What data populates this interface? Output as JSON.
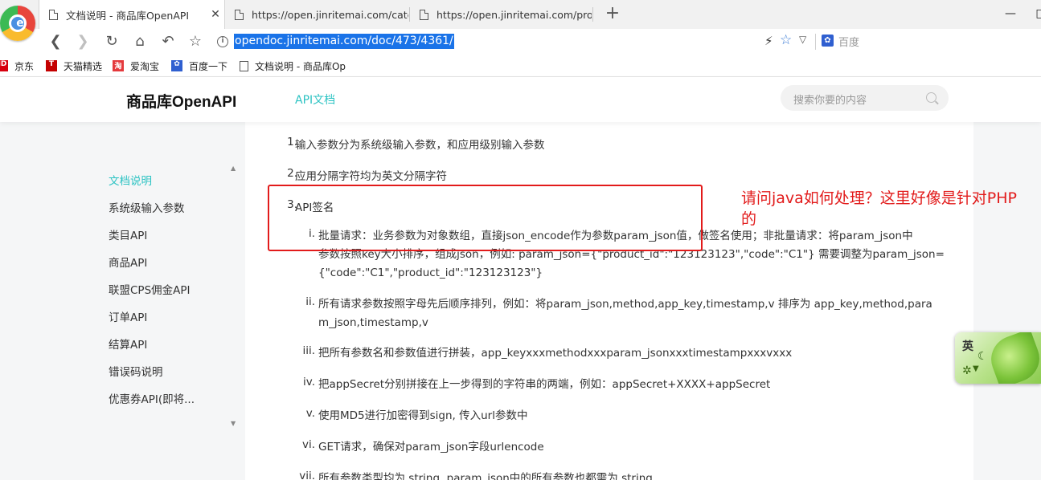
{
  "browser": {
    "tabs": [
      {
        "label": "文档说明 - 商品库OpenAPI",
        "active": true
      },
      {
        "label": "https://open.jinritemai.com/cate/",
        "active": false
      },
      {
        "label": "https://open.jinritemai.com/prod",
        "active": false
      }
    ],
    "new_tab_glyph": "+",
    "window_buttons": {
      "minimize": "—",
      "maximize": "□"
    },
    "url": "opendoc.jinritemai.com/doc/473/4361/",
    "search_placeholder": "百度",
    "bookmarks": [
      {
        "label": "京东",
        "icon": "jd-icon",
        "color": "#d7000f"
      },
      {
        "label": "天猫精选",
        "icon": "tmall-icon",
        "color": "#c40000"
      },
      {
        "label": "爱淘宝",
        "icon": "taobao-icon",
        "color": "#e4393c"
      },
      {
        "label": "百度一下",
        "icon": "baidu-icon",
        "color": "#2f5fd0"
      },
      {
        "label": "文档说明 - 商品库Op",
        "icon": "page-icon",
        "color": "#555555"
      }
    ]
  },
  "site": {
    "title": "商品库OpenAPI",
    "nav_link": "API文档",
    "search_placeholder": "搜索你要的内容",
    "accent_color": "#2cc3c3"
  },
  "sidebar": {
    "items": [
      {
        "label": "文档说明",
        "active": true
      },
      {
        "label": "系统级输入参数",
        "active": false
      },
      {
        "label": "类目API",
        "active": false
      },
      {
        "label": "商品API",
        "active": false
      },
      {
        "label": "联盟CPS佣金API",
        "active": false
      },
      {
        "label": "订单API",
        "active": false
      },
      {
        "label": "结算API",
        "active": false
      },
      {
        "label": "错误码说明",
        "active": false
      },
      {
        "label": "优惠券API(即将...",
        "active": false
      }
    ]
  },
  "doc": {
    "items": [
      {
        "num": "1.",
        "text": "输入参数分为系统级输入参数，和应用级别输入参数"
      },
      {
        "num": "2.",
        "text": "应用分隔字符均为英文分隔字符"
      },
      {
        "num": "3.",
        "text": "API签名"
      }
    ],
    "sub_items": [
      {
        "num": "i.",
        "lines": [
          "批量请求：业务参数为对象数组，直接json_encode作为参数param_json值，做签名使用；非批量请求：将param_json中",
          "参数按照key大小排序，组成json，例如: param_json={\"product_id\":\"123123123\",\"code\":\"C1\"} 需要调整为param_json=",
          "{\"code\":\"C1\",\"product_id\":\"123123123\"}"
        ]
      },
      {
        "num": "ii.",
        "lines": [
          "所有请求参数按照字母先后顺序排列，例如：将param_json,method,app_key,timestamp,v 排序为 app_key,method,para",
          "m_json,timestamp,v"
        ]
      },
      {
        "num": "iii.",
        "lines": [
          "把所有参数名和参数值进行拼装，app_keyxxxmethodxxxparam_jsonxxxtimestampxxxvxxx"
        ]
      },
      {
        "num": "iv.",
        "lines": [
          "把appSecret分别拼接在上一步得到的字符串的两端，例如：appSecret+XXXX+appSecret"
        ]
      },
      {
        "num": "v.",
        "lines": [
          "使用MD5进行加密得到sign, 传入url参数中"
        ]
      },
      {
        "num": "vi.",
        "lines": [
          "GET请求，确保对param_json字段urlencode"
        ]
      },
      {
        "num": "vii.",
        "lines": [
          "所有参数类型均为 string, param_json中的所有参数也都需为 string"
        ]
      }
    ]
  },
  "annotation": {
    "text": "请问java如何处理？这里好像是针对PHP的",
    "color": "#e21b1b"
  },
  "ime": {
    "label": "英"
  }
}
